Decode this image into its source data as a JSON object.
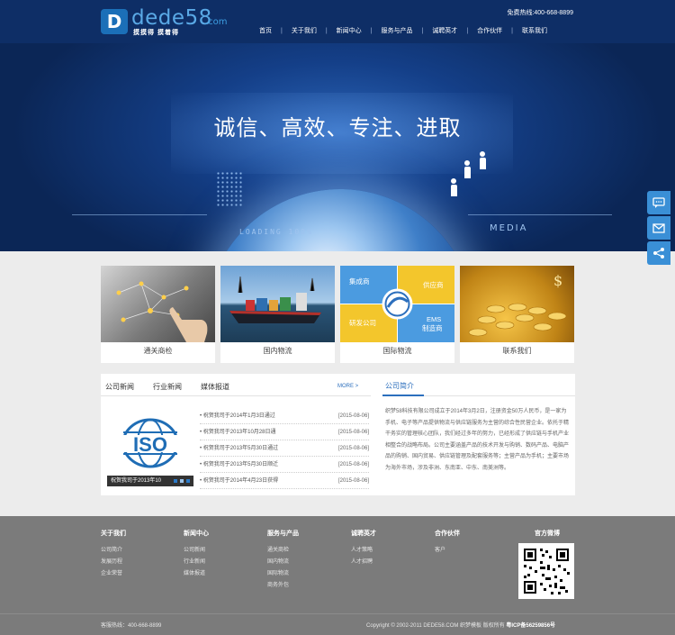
{
  "header": {
    "logo_text": "dede58",
    "logo_domain": ".com",
    "logo_sub": "摸摸得 摸着得",
    "hotline": "免费热线:400-668-8899",
    "nav": [
      "首页",
      "关于我们",
      "新闻中心",
      "服务与产品",
      "诚聘英才",
      "合作伙伴",
      "联系我们"
    ]
  },
  "banner": {
    "slogan": "诚信、高效、专注、进取",
    "loading_text": "LOADING 100%",
    "media_text": "MEDIA"
  },
  "side_buttons": [
    {
      "icon": "chat-icon"
    },
    {
      "icon": "mail-icon"
    },
    {
      "icon": "share-icon"
    }
  ],
  "boxes": [
    {
      "caption": "通关商检",
      "icon": "touch-network-image"
    },
    {
      "caption": "国内物流",
      "icon": "cargo-ship-image"
    },
    {
      "caption": "国际物流",
      "icon": "supply-chain-diagram",
      "diagram": {
        "tl": "集成商",
        "tr": "供应商",
        "bl": "研发公司",
        "br": "EMS\n制造商"
      }
    },
    {
      "caption": "联系我们",
      "icon": "gold-coins-image"
    }
  ],
  "news": {
    "tabs": [
      "公司新闻",
      "行业新闻",
      "媒体报道"
    ],
    "more": "MORE >",
    "iso_text": "ISO",
    "iso_caption": "祝贺我司于2013年10",
    "items": [
      {
        "title": "• 祝贺我司于2014年1月3日通过",
        "date": "[2015-08-06]"
      },
      {
        "title": "• 祝贺我司于2013年10月28日通",
        "date": "[2015-08-06]"
      },
      {
        "title": "• 祝贺我司于2013年5月30日通过",
        "date": "[2015-08-06]"
      },
      {
        "title": "• 祝贺我司于2013年5月30日顺迁",
        "date": "[2015-08-06]"
      },
      {
        "title": "• 祝贺我司于2014年4月23日获得",
        "date": "[2015-08-06]"
      }
    ]
  },
  "about": {
    "title": "公司简介",
    "text": "织梦58科技有限公司成立于2014年3月2日，注册资金50万人民币，是一家为手机、电子等产品提供物流与供应链服务为主营的综合性民营企业。依托于精干务实的管理核心团队，我们经过多年的努力，已经形成了供应链与手机产业相整合的战略布局。公司主要涵盖产品的技术开发与购销、数码产品、电脑产品的购销、国内贸易、供应链管理及配套服务等；主营产品为手机；主要市场为海外市场，涉及非洲、东南亚、中东、南美洲等。"
  },
  "footer": {
    "cols": [
      {
        "title": "关于我们",
        "items": [
          "公司简介",
          "发展历程",
          "企业荣誉"
        ]
      },
      {
        "title": "新闻中心",
        "items": [
          "公司新闻",
          "行业新闻",
          "媒体报道"
        ]
      },
      {
        "title": "服务与产品",
        "items": [
          "通关商检",
          "国内物流",
          "国际物流",
          "商务外包"
        ]
      },
      {
        "title": "诚聘英才",
        "items": [
          "人才策略",
          "人才招聘"
        ]
      },
      {
        "title": "合作伙伴",
        "items": [
          "客户"
        ]
      }
    ],
    "weibo_title": "官方微博",
    "hotline": "客服热线：400-668-8899",
    "copyright": "Copyright © 2002-2011 DEDE58.COM 织梦模板 版权所有 ",
    "icp": "粤ICP备56259856号"
  },
  "colors": {
    "header_bg": "#0e2e66",
    "accent": "#2c6fbd",
    "side_btn": "#3a8fd6",
    "footer_bg": "#7b7b7b"
  }
}
